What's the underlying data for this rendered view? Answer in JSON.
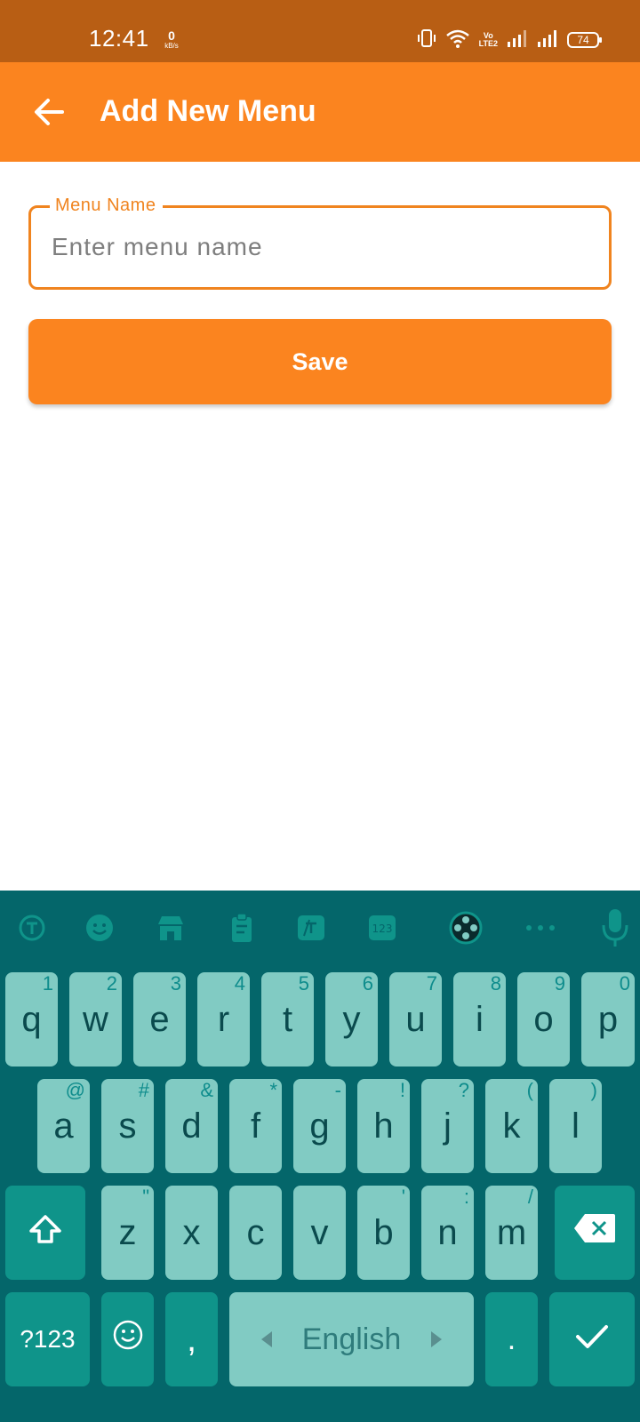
{
  "status_bar": {
    "time": "12:41",
    "net_speed_value": "0",
    "net_speed_unit": "kB/s",
    "volte": "Vo\nLTE2",
    "battery": "74"
  },
  "app_bar": {
    "title": "Add New Menu"
  },
  "form": {
    "menu_name_label": "Menu Name",
    "menu_name_placeholder": "Enter menu name",
    "menu_name_value": "",
    "save_label": "Save"
  },
  "keyboard": {
    "row1": [
      {
        "key": "q",
        "hint": "1"
      },
      {
        "key": "w",
        "hint": "2"
      },
      {
        "key": "e",
        "hint": "3"
      },
      {
        "key": "r",
        "hint": "4"
      },
      {
        "key": "t",
        "hint": "5"
      },
      {
        "key": "y",
        "hint": "6"
      },
      {
        "key": "u",
        "hint": "7"
      },
      {
        "key": "i",
        "hint": "8"
      },
      {
        "key": "o",
        "hint": "9"
      },
      {
        "key": "p",
        "hint": "0"
      }
    ],
    "row2": [
      {
        "key": "a",
        "hint": "@"
      },
      {
        "key": "s",
        "hint": "#"
      },
      {
        "key": "d",
        "hint": "&"
      },
      {
        "key": "f",
        "hint": "*"
      },
      {
        "key": "g",
        "hint": "-"
      },
      {
        "key": "h",
        "hint": "!"
      },
      {
        "key": "j",
        "hint": "?"
      },
      {
        "key": "k",
        "hint": "("
      },
      {
        "key": "l",
        "hint": ")"
      }
    ],
    "row3": [
      {
        "key": "z",
        "hint": "\""
      },
      {
        "key": "x",
        "hint": ""
      },
      {
        "key": "c",
        "hint": ""
      },
      {
        "key": "v",
        "hint": ""
      },
      {
        "key": "b",
        "hint": "'"
      },
      {
        "key": "n",
        "hint": ":"
      },
      {
        "key": "m",
        "hint": "/"
      }
    ],
    "symbols_label": "?123",
    "comma_label": ",",
    "space_label": "English",
    "period_label": ".",
    "toolbar_badge": "123"
  },
  "colors": {
    "status_bar": "#b85e14",
    "accent": "#fb841f",
    "keyboard_bg": "#04666a",
    "key_light": "#81cbc3",
    "key_dark": "#0f948a"
  }
}
